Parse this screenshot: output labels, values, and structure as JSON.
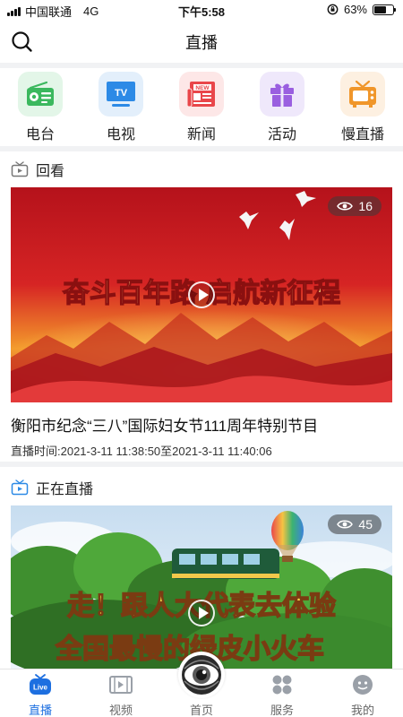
{
  "status_bar": {
    "carrier": "中国联通",
    "network": "4G",
    "time": "下午5:58",
    "battery_text": "63%",
    "battery_level": 0.63
  },
  "header": {
    "title": "直播",
    "search_icon": "search-icon"
  },
  "categories": [
    {
      "label": "电台",
      "icon": "radio-icon",
      "bg": "#e3f6e8",
      "color": "#3bb85e"
    },
    {
      "label": "电视",
      "icon": "tv-icon",
      "bg": "#e3effb",
      "color": "#2c8ae6",
      "icon_text": "TV"
    },
    {
      "label": "新闻",
      "icon": "newspaper-icon",
      "bg": "#fde7e7",
      "color": "#e9464a",
      "icon_text": "NEW"
    },
    {
      "label": "活动",
      "icon": "gift-icon",
      "bg": "#efe8fb",
      "color": "#9a5fe0"
    },
    {
      "label": "慢直播",
      "icon": "retro-tv-icon",
      "bg": "#fdf0e1",
      "color": "#f0962a"
    }
  ],
  "replay": {
    "section_title": "回看",
    "views": "16",
    "banner_text": "奋斗百年路 启航新征程",
    "title": "衡阳市纪念“三八”国际妇女节111周年特别节目",
    "time_text": "直播时间:2021-3-11 11:38:50至2021-3-11 11:40:06"
  },
  "live": {
    "section_title": "正在直播",
    "views": "45",
    "banner_line1": "走！跟人大代表去体验",
    "banner_line2": "全国最慢的绿皮小火车"
  },
  "tabbar": {
    "tabs": [
      {
        "label": "直播",
        "icon": "live-tv-icon",
        "active": true
      },
      {
        "label": "视频",
        "icon": "film-icon",
        "active": false
      },
      {
        "label": "首页",
        "icon": "eye-logo-icon",
        "active": false
      },
      {
        "label": "服务",
        "icon": "grid-icon",
        "active": false
      },
      {
        "label": "我的",
        "icon": "profile-icon",
        "active": false
      }
    ],
    "active_color": "#1d6fe0",
    "inactive_color": "#9aa0a8"
  }
}
